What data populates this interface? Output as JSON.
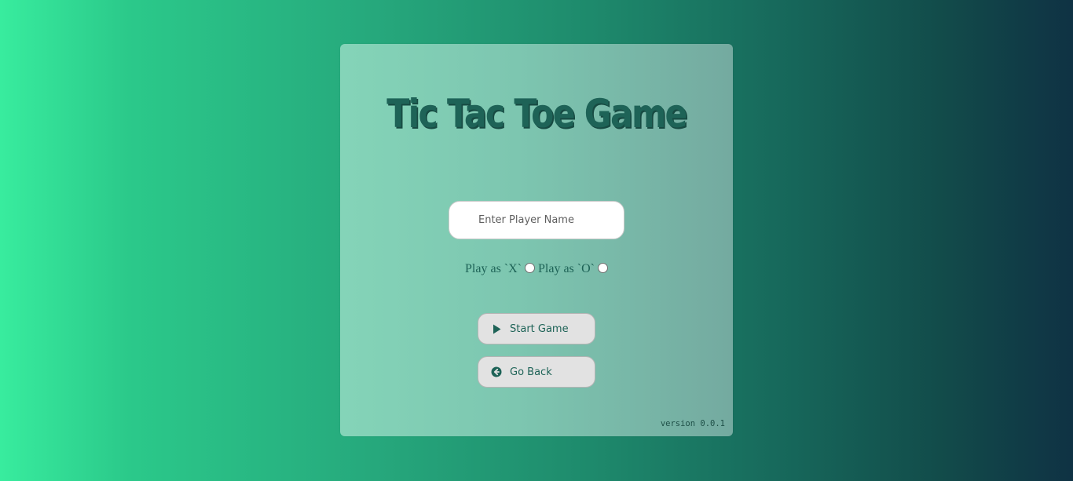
{
  "card": {
    "title": "Tic Tac Toe Game",
    "player_input": {
      "placeholder": "Enter Player Name",
      "value": ""
    },
    "choices": {
      "x_label": "Play as `X`",
      "o_label": "Play as `O`"
    },
    "buttons": {
      "start_label": "Start Game",
      "start_icon": "play-icon",
      "back_label": "Go Back",
      "back_icon": "arrow-circle-left-icon"
    },
    "version": "version 0.0.1"
  },
  "colors": {
    "accent": "#1e6357",
    "gradient_start": "#38ec9e",
    "gradient_end": "#0f3244"
  }
}
